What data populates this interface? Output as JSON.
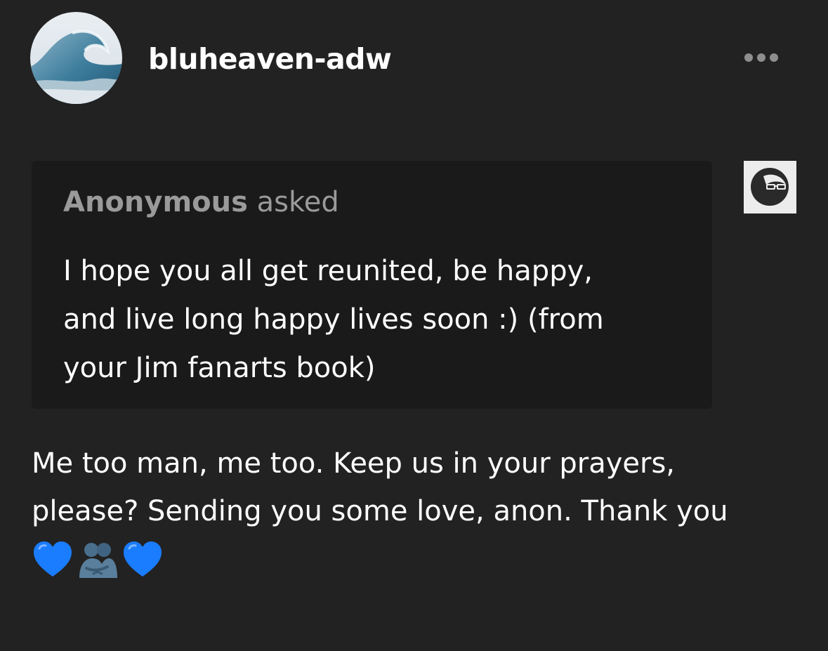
{
  "post": {
    "username": "bluheaven-adw",
    "avatar_icon": "wave-avatar-icon",
    "more_icon": "ellipsis-icon"
  },
  "ask": {
    "asker_name": "Anonymous",
    "asked_label": "asked",
    "asker_avatar_icon": "sunglasses-anon-avatar-icon",
    "question_lines": [
      "I hope you all get reunited, be happy,",
      "and live long happy lives soon :) (from",
      "your Jim fanarts book)"
    ]
  },
  "answer": {
    "lines": [
      "Me too man, me too.  Keep us in your prayers,",
      "please?  Sending you some love, anon.  Thank you"
    ],
    "emojis": [
      "blue-heart-icon",
      "people-hugging-icon",
      "blue-heart-icon"
    ]
  },
  "colors": {
    "background": "#222222",
    "bubble": "#1a1a1a",
    "text": "#ffffff",
    "muted": "#9a9a9a",
    "heart": "#1a7cff"
  }
}
